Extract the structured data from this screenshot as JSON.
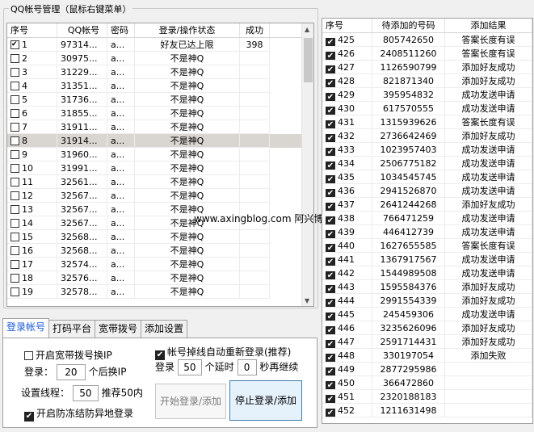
{
  "left": {
    "group_title": "QQ帐号管理（鼠标右键菜单）",
    "columns": [
      "序号",
      "QQ帐号",
      "密码",
      "登录/操作状态",
      "成功"
    ],
    "rows": [
      {
        "checked": true,
        "idx": "1",
        "qq": "97314...",
        "pw": "a...",
        "status": "好友已达上限",
        "ok": "398"
      },
      {
        "checked": false,
        "idx": "2",
        "qq": "30975...",
        "pw": "a...",
        "status": "不是神Q",
        "ok": ""
      },
      {
        "checked": false,
        "idx": "3",
        "qq": "31229...",
        "pw": "a...",
        "status": "不是神Q",
        "ok": ""
      },
      {
        "checked": false,
        "idx": "4",
        "qq": "31351...",
        "pw": "a...",
        "status": "不是神Q",
        "ok": ""
      },
      {
        "checked": false,
        "idx": "5",
        "qq": "31736...",
        "pw": "a...",
        "status": "不是神Q",
        "ok": ""
      },
      {
        "checked": false,
        "idx": "6",
        "qq": "31855...",
        "pw": "a...",
        "status": "不是神Q",
        "ok": ""
      },
      {
        "checked": false,
        "idx": "7",
        "qq": "31911...",
        "pw": "a...",
        "status": "不是神Q",
        "ok": ""
      },
      {
        "checked": false,
        "idx": "8",
        "qq": "31914...",
        "pw": "a...",
        "status": "不是神Q",
        "ok": "",
        "selected": true
      },
      {
        "checked": false,
        "idx": "9",
        "qq": "31960...",
        "pw": "a...",
        "status": "不是神Q",
        "ok": ""
      },
      {
        "checked": false,
        "idx": "10",
        "qq": "31991...",
        "pw": "a...",
        "status": "不是神Q",
        "ok": ""
      },
      {
        "checked": false,
        "idx": "11",
        "qq": "32561...",
        "pw": "a...",
        "status": "不是神Q",
        "ok": ""
      },
      {
        "checked": false,
        "idx": "12",
        "qq": "32567...",
        "pw": "a...",
        "status": "不是神Q",
        "ok": ""
      },
      {
        "checked": false,
        "idx": "13",
        "qq": "32567...",
        "pw": "a...",
        "status": "不是神Q",
        "ok": ""
      },
      {
        "checked": false,
        "idx": "14",
        "qq": "32567...",
        "pw": "a...",
        "status": "不是神Q",
        "ok": ""
      },
      {
        "checked": false,
        "idx": "15",
        "qq": "32568...",
        "pw": "a...",
        "status": "不是神Q",
        "ok": ""
      },
      {
        "checked": false,
        "idx": "16",
        "qq": "32568...",
        "pw": "a...",
        "status": "不是神Q",
        "ok": ""
      },
      {
        "checked": false,
        "idx": "17",
        "qq": "32574...",
        "pw": "a...",
        "status": "不是神Q",
        "ok": ""
      },
      {
        "checked": false,
        "idx": "18",
        "qq": "32576...",
        "pw": "a...",
        "status": "不是神Q",
        "ok": ""
      },
      {
        "checked": false,
        "idx": "19",
        "qq": "32578...",
        "pw": "a...",
        "status": "不是神Q",
        "ok": ""
      }
    ]
  },
  "right": {
    "columns": [
      "序号",
      "待添加的号码",
      "添加结果"
    ],
    "rows": [
      {
        "idx": "425",
        "num": "805742650",
        "res": "答案长度有误"
      },
      {
        "idx": "426",
        "num": "2408511260",
        "res": "答案长度有误"
      },
      {
        "idx": "427",
        "num": "1126590799",
        "res": "添加好友成功"
      },
      {
        "idx": "428",
        "num": "821871340",
        "res": "添加好友成功"
      },
      {
        "idx": "429",
        "num": "395954832",
        "res": "成功发送申请"
      },
      {
        "idx": "430",
        "num": "617570555",
        "res": "成功发送申请"
      },
      {
        "idx": "431",
        "num": "1315939626",
        "res": "答案长度有误"
      },
      {
        "idx": "432",
        "num": "2736642469",
        "res": "添加好友成功"
      },
      {
        "idx": "433",
        "num": "1023957403",
        "res": "成功发送申请"
      },
      {
        "idx": "434",
        "num": "2506775182",
        "res": "成功发送申请"
      },
      {
        "idx": "435",
        "num": "1034545745",
        "res": "成功发送申请"
      },
      {
        "idx": "436",
        "num": "2941526870",
        "res": "成功发送申请"
      },
      {
        "idx": "437",
        "num": "2641244268",
        "res": "添加好友成功"
      },
      {
        "idx": "438",
        "num": "766471259",
        "res": "成功发送申请"
      },
      {
        "idx": "439",
        "num": "446412739",
        "res": "成功发送申请"
      },
      {
        "idx": "440",
        "num": "1627655585",
        "res": "答案长度有误"
      },
      {
        "idx": "441",
        "num": "1367917567",
        "res": "成功发送申请"
      },
      {
        "idx": "442",
        "num": "1544989508",
        "res": "成功发送申请"
      },
      {
        "idx": "443",
        "num": "1595584376",
        "res": "添加好友成功"
      },
      {
        "idx": "444",
        "num": "2991554339",
        "res": "添加好友成功"
      },
      {
        "idx": "445",
        "num": "245459306",
        "res": "成功发送申请"
      },
      {
        "idx": "446",
        "num": "3235626096",
        "res": "添加好友成功"
      },
      {
        "idx": "447",
        "num": "2591714431",
        "res": "添加好友成功"
      },
      {
        "idx": "448",
        "num": "330197054",
        "res": "添加失败"
      },
      {
        "idx": "449",
        "num": "2877295986",
        "res": ""
      },
      {
        "idx": "450",
        "num": "366472860",
        "res": ""
      },
      {
        "idx": "451",
        "num": "2320188183",
        "res": ""
      },
      {
        "idx": "452",
        "num": "1211631498",
        "res": ""
      }
    ]
  },
  "watermark": "www.axingblog.com 阿兴博客",
  "tabs": [
    "登录帐号",
    "打码平台",
    "宽带拨号",
    "添加设置"
  ],
  "settings": {
    "broadband_label": "开启宽带拨号换IP",
    "login_prefix": "登录：",
    "login_value": "20",
    "login_suffix": "个后换IP",
    "threads_prefix": "设置线程：",
    "threads_value": "50",
    "threads_suffix": "推荐50内",
    "antifreeze_label": "开启防冻结防异地登录",
    "relogin_label": "帐号掉线自动重新登录(推荐)",
    "delay_prefix": "登录",
    "delay_value1": "50",
    "delay_mid": "个延时",
    "delay_value2": "0",
    "delay_suffix": "秒再继续",
    "start_button": "开始登录/添加",
    "stop_button": "停止登录/添加"
  }
}
